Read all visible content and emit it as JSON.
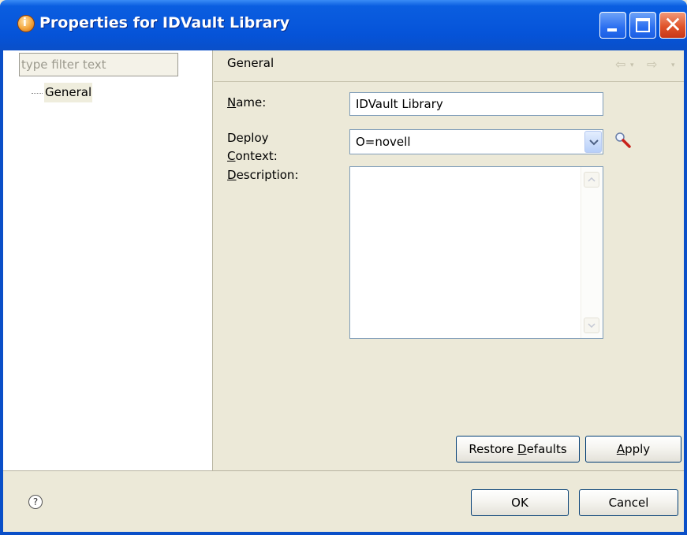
{
  "window": {
    "title": "Properties for IDVault Library",
    "icon": "app-icon",
    "controls": {
      "minimize": "minimize-icon",
      "maximize": "maximize-icon",
      "close": "close-icon"
    }
  },
  "sidebar": {
    "filter_placeholder": "type filter text",
    "items": [
      {
        "label": "General",
        "selected": true
      }
    ]
  },
  "page": {
    "title": "General",
    "nav": {
      "back": "⇦",
      "forward": "⇨",
      "dropdown": "▾"
    }
  },
  "form": {
    "name_label": {
      "accel": "N",
      "rest": "ame:"
    },
    "name_value": "IDVault Library",
    "context_label_line1": "Deploy",
    "context_label_line2": {
      "accel": "C",
      "rest": "ontext:"
    },
    "context_value": "O=novell",
    "description_label": {
      "accel": "D",
      "rest": "escription:"
    },
    "description_value": ""
  },
  "buttons": {
    "restore_defaults": {
      "before": "Restore ",
      "accel": "D",
      "after": "efaults"
    },
    "apply": {
      "before": "",
      "accel": "A",
      "after": "pply"
    },
    "ok": "OK",
    "cancel": "Cancel"
  },
  "footer": {
    "help": "?"
  },
  "colors": {
    "titlebar": "#0858dc",
    "dialog_bg": "#ece9d8",
    "input_border": "#7f9db9",
    "button_border": "#003c74"
  }
}
